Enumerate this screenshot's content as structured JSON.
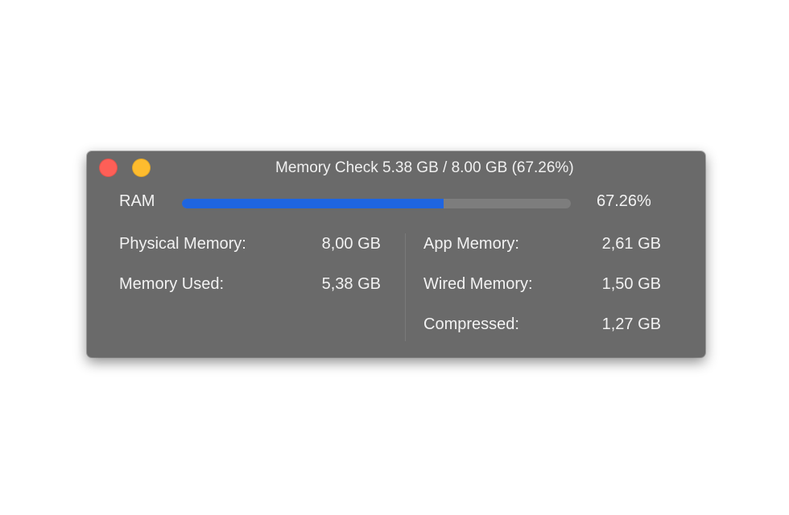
{
  "window": {
    "title": "Memory Check 5.38 GB / 8.00 GB (67.26%)"
  },
  "ram": {
    "label": "RAM",
    "percent_text": "67.26%",
    "usage_fraction": 0.6726,
    "bar_color": "#1f65e0",
    "track_color": "#7d7d7d"
  },
  "left_stats": [
    {
      "label": "Physical Memory:",
      "value": "8,00 GB"
    },
    {
      "label": "Memory Used:",
      "value": "5,38 GB"
    }
  ],
  "right_stats": [
    {
      "label": "App Memory:",
      "value": "2,61 GB"
    },
    {
      "label": "Wired Memory:",
      "value": "1,50 GB"
    },
    {
      "label": "Compressed:",
      "value": "1,27 GB"
    }
  ],
  "colors": {
    "window_background": "#6a6a6a",
    "close_button": "#fe5f57",
    "minimize_button": "#febc2e"
  }
}
